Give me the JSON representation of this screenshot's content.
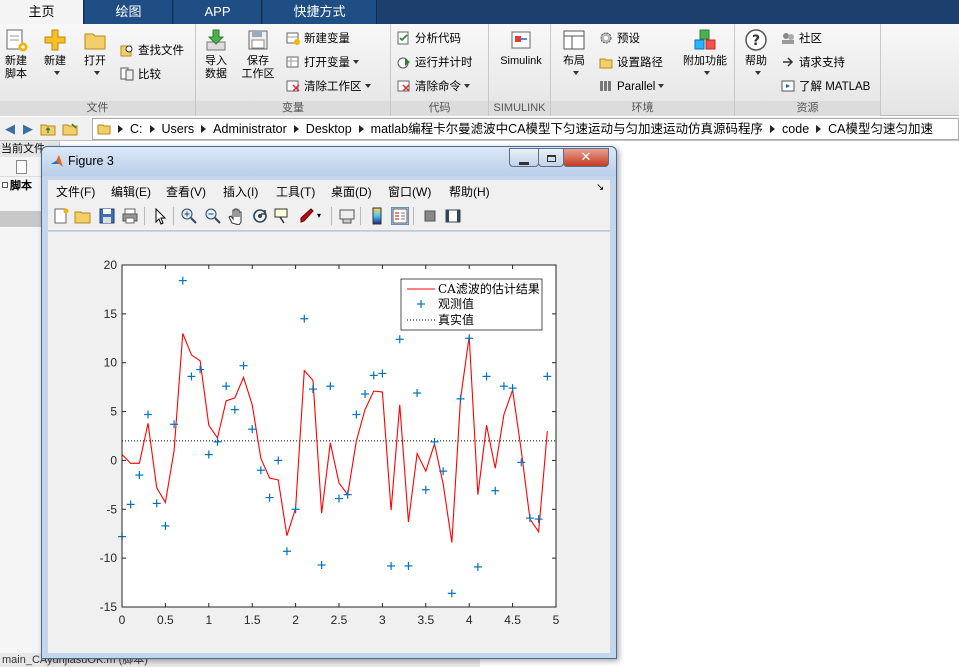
{
  "tabs": [
    {
      "label": "主页",
      "active": true
    },
    {
      "label": "绘图",
      "active": false
    },
    {
      "label": "APP",
      "active": false
    },
    {
      "label": "快捷方式",
      "active": false
    }
  ],
  "ribbon": {
    "file": {
      "label": "文件",
      "new_script": "新建\n脚本",
      "new": "新建",
      "open": "打开",
      "find_files": "查找文件",
      "compare": "比较"
    },
    "variable": {
      "label": "变量",
      "import_data": "导入\n数据",
      "save_workspace": "保存\n工作区",
      "new_variable": "新建变量",
      "open_variable": "打开变量",
      "clear_workspace": "清除工作区"
    },
    "code": {
      "label": "代码",
      "analyze": "分析代码",
      "run_time": "运行并计时",
      "clear_commands": "清除命令"
    },
    "simulink": {
      "label": "SIMULINK",
      "button": "Simulink"
    },
    "environment": {
      "label": "环境",
      "layout": "布局",
      "preferences": "预设",
      "set_path": "设置路径",
      "parallel": "Parallel",
      "addons": "附加功能"
    },
    "resources": {
      "label": "资源",
      "help": "帮助",
      "community": "社区",
      "request_support": "请求支持",
      "learn": "了解 MATLAB"
    }
  },
  "path": [
    "C:",
    "Users",
    "Administrator",
    "Desktop",
    "matlab编程卡尔曼滤波中CA模型下匀速运动与匀加速运动仿真源码程序",
    "code",
    "CA模型匀速匀加速"
  ],
  "left_panel": {
    "title": "当前文件",
    "folder": "脚本"
  },
  "status_bar": "main_CAyunjiasuOK.m  (脚本)",
  "figure": {
    "title": "Figure 3",
    "menu": [
      "文件(F)",
      "编辑(E)",
      "查看(V)",
      "插入(I)",
      "工具(T)",
      "桌面(D)",
      "窗口(W)",
      "帮助(H)"
    ],
    "toolbar_icons": [
      "new-figure-icon",
      "open-file-icon",
      "save-icon",
      "print-icon",
      "pointer-icon",
      "zoom-in-icon",
      "zoom-out-icon",
      "pan-icon",
      "rotate-icon",
      "data-cursor-icon",
      "brush-icon",
      "link-plot-icon",
      "colorbar-icon",
      "legend-icon",
      "hide-plot-tools-icon",
      "show-plot-tools-icon"
    ]
  },
  "chart_data": {
    "type": "line",
    "title": "",
    "xlabel": "",
    "ylabel": "",
    "xlim": [
      0,
      5
    ],
    "ylim": [
      -15,
      20
    ],
    "xticks": [
      "0",
      "0.5",
      "1",
      "1.5",
      "2",
      "2.5",
      "3",
      "3.5",
      "4",
      "4.5",
      "5"
    ],
    "yticks": [
      "-15",
      "-10",
      "-5",
      "0",
      "5",
      "10",
      "15",
      "20"
    ],
    "grid": false,
    "legend_position": "top-right",
    "series": [
      {
        "name": "CA滤波的估计结果",
        "style": "line",
        "color": "#ff0000",
        "x": [
          0,
          0.1,
          0.2,
          0.3,
          0.4,
          0.5,
          0.6,
          0.7,
          0.8,
          0.9,
          1.0,
          1.1,
          1.2,
          1.3,
          1.4,
          1.5,
          1.6,
          1.7,
          1.8,
          1.9,
          2.0,
          2.1,
          2.2,
          2.3,
          2.4,
          2.5,
          2.6,
          2.7,
          2.8,
          2.9,
          3.0,
          3.1,
          3.2,
          3.3,
          3.4,
          3.5,
          3.6,
          3.7,
          3.8,
          3.9,
          4.0,
          4.1,
          4.2,
          4.3,
          4.4,
          4.5,
          4.6,
          4.7,
          4.8,
          4.9
        ],
        "y": [
          0.6,
          -0.3,
          -0.3,
          3.8,
          -2.8,
          -4.3,
          1.0,
          13.0,
          10.8,
          10.2,
          3.6,
          2.3,
          6.1,
          6.4,
          8.5,
          5.7,
          0.2,
          -1.8,
          -2.0,
          -7.7,
          -4.9,
          9.2,
          8.2,
          -5.4,
          1.8,
          -2.3,
          -3.5,
          2.0,
          5.2,
          7.1,
          7.0,
          -5.1,
          5.7,
          -6.3,
          0.7,
          -1.1,
          1.7,
          -2.4,
          -8.4,
          6.3,
          12.7,
          -3.5,
          3.6,
          -0.8,
          4.7,
          7.2,
          1.0,
          -6.0,
          -7.3,
          3.0
        ]
      },
      {
        "name": "观测值",
        "style": "marker",
        "marker": "+",
        "color": "#0072bd",
        "x": [
          0,
          0.1,
          0.2,
          0.3,
          0.4,
          0.5,
          0.6,
          0.7,
          0.8,
          0.9,
          1.0,
          1.1,
          1.2,
          1.3,
          1.4,
          1.5,
          1.6,
          1.7,
          1.8,
          1.9,
          2.0,
          2.1,
          2.2,
          2.3,
          2.4,
          2.5,
          2.6,
          2.7,
          2.8,
          2.9,
          3.0,
          3.1,
          3.2,
          3.3,
          3.4,
          3.5,
          3.6,
          3.7,
          3.8,
          3.9,
          4.0,
          4.1,
          4.2,
          4.3,
          4.4,
          4.5,
          4.6,
          4.7,
          4.8,
          4.9
        ],
        "y": [
          -7.8,
          -4.5,
          -1.5,
          4.7,
          -4.4,
          -6.7,
          3.7,
          18.4,
          8.6,
          9.3,
          0.6,
          1.9,
          7.6,
          5.2,
          9.7,
          3.2,
          -1.0,
          -3.8,
          0.0,
          -9.3,
          -5.0,
          14.5,
          7.3,
          -10.7,
          7.6,
          -3.9,
          -3.5,
          4.7,
          6.8,
          8.7,
          8.9,
          -10.8,
          12.4,
          -10.8,
          6.9,
          -3.0,
          1.9,
          -1.1,
          -13.6,
          6.3,
          12.5,
          -10.9,
          8.6,
          -3.1,
          7.6,
          7.4,
          -0.2,
          -5.9,
          -6.0,
          8.6
        ]
      },
      {
        "name": "真实值",
        "style": "dotted",
        "color": "#000000",
        "x": [
          0,
          5
        ],
        "y": [
          2,
          2
        ]
      }
    ]
  }
}
